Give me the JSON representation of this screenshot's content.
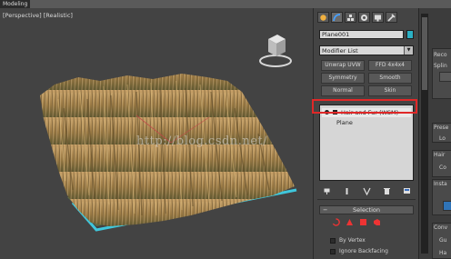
{
  "window": {
    "title": "Modeling"
  },
  "viewport": {
    "label_view": "[Perspective]",
    "label_shading": "[Realistic]",
    "watermark": "http://blog.csdn.net/"
  },
  "command_panel": {
    "tabs": [
      "create-icon",
      "modify-icon",
      "hierarchy-icon",
      "motion-icon",
      "display-icon",
      "utilities-icon"
    ],
    "object_name": "Plane001",
    "object_color": "#2bb0c4",
    "modifier_list": "Modifier List",
    "modifier_buttons": [
      {
        "label": "Unwrap UVW"
      },
      {
        "label": "FFD 4x4x4"
      },
      {
        "label": "Symmetry"
      },
      {
        "label": "Smooth"
      },
      {
        "label": "Normal"
      },
      {
        "label": "Skin"
      }
    ],
    "stack": {
      "selected": "Hair and Fur (WSM)",
      "base": "Plane"
    },
    "selection_rollout": {
      "title": "Selection",
      "by_vertex": "By Vertex",
      "ignore_backfacing": "Ignore Backfacing"
    },
    "highlight_color": "#e02828"
  },
  "right_panel": {
    "labels": [
      "Reco",
      "Splin",
      "Prese",
      "Lo",
      "Hair",
      "Co",
      "Insta",
      "Conv",
      "Gu",
      "Ha"
    ]
  }
}
